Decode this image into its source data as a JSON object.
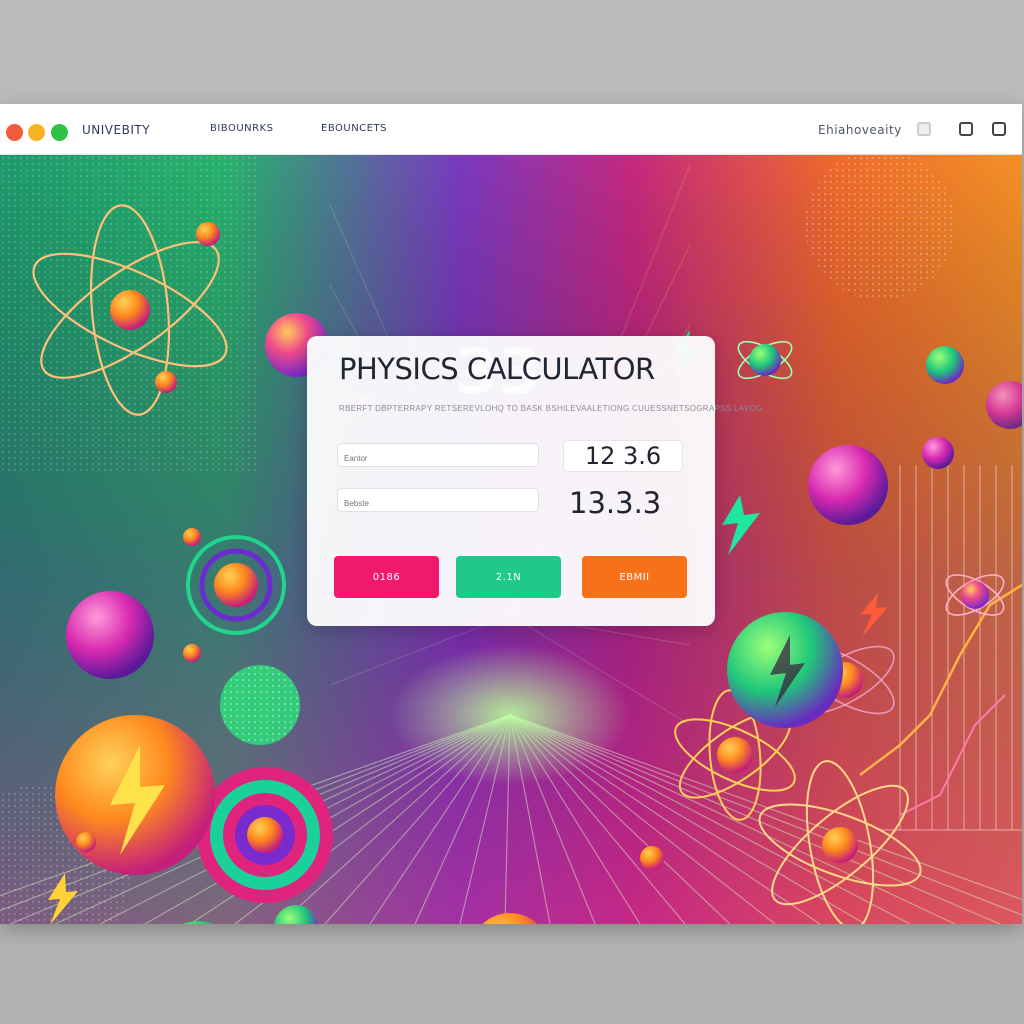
{
  "window": {
    "traffic_lights": [
      "#f25a3c",
      "#f5b324",
      "#2ec24a"
    ],
    "nav_links": [
      "UNIVEBITY",
      "BIBOUNRKS",
      "EBOUNCETS"
    ],
    "nav_right_label": "Ehiahoveaity"
  },
  "hero": {
    "number": "33"
  },
  "calculator": {
    "title": "PHYSICS CALCULATOR",
    "subtitle": "RBERFT DBPTERRAPY RETSEREVLOHQ TO BASK BSHILEVAALETIONG CUUESSNETSOGRAPSS LAVOG",
    "fields": [
      {
        "placeholder": "Eantor",
        "readout": "12 3.6"
      },
      {
        "placeholder": "Bebste",
        "readout": "13.3.3"
      }
    ],
    "buttons": [
      {
        "label": "0186",
        "color": "#f0196e"
      },
      {
        "label": "2.1N",
        "color": "#1ec98a"
      },
      {
        "label": "EBMII",
        "color": "#f7711b"
      }
    ]
  },
  "scene": {
    "colors": {
      "green": "#19c77a",
      "purple": "#8a2bd0",
      "magenta": "#e7259a",
      "orange": "#f5891e"
    }
  }
}
